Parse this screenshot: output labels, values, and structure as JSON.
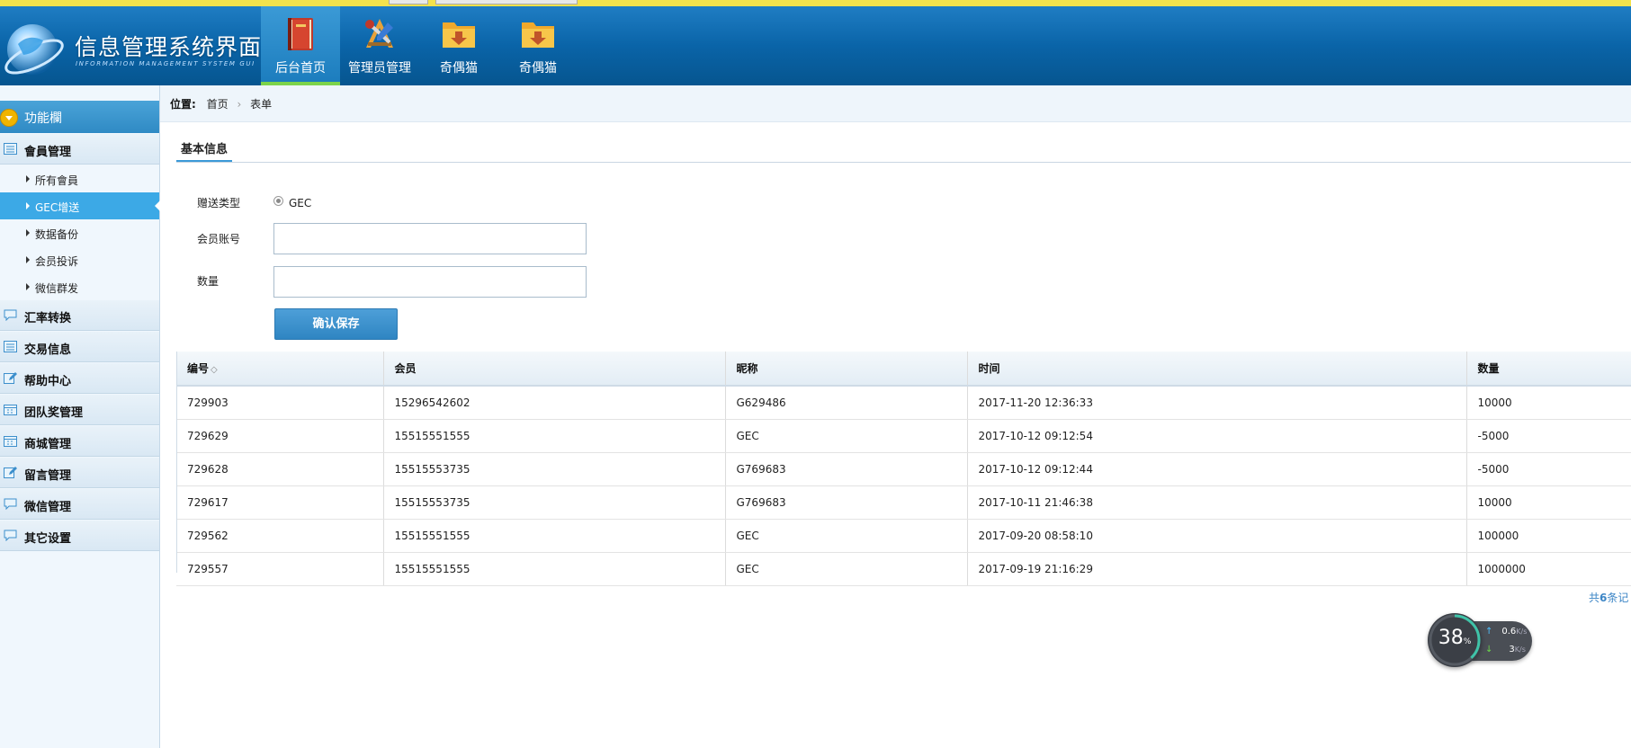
{
  "header": {
    "title": "信息管理系统界面",
    "subtitle": "INFORMATION MANAGEMENT SYSTEM GUI",
    "nav": [
      {
        "label": "后台首页",
        "icon": "book-icon",
        "active": true
      },
      {
        "label": "管理员管理",
        "icon": "tools-icon",
        "active": false
      },
      {
        "label": "奇偶猫",
        "icon": "folder-download-icon",
        "active": false
      },
      {
        "label": "奇偶猫",
        "icon": "folder-download-icon",
        "active": false
      }
    ]
  },
  "sidebar": {
    "heading": "功能欄",
    "groups": [
      {
        "label": "會員管理",
        "icon": "list-icon"
      },
      {
        "label": "汇率转换",
        "icon": "chat-icon"
      },
      {
        "label": "交易信息",
        "icon": "list-icon"
      },
      {
        "label": "帮助中心",
        "icon": "edit-icon"
      },
      {
        "label": "团队奖管理",
        "icon": "calendar-icon"
      },
      {
        "label": "商城管理",
        "icon": "calendar-icon"
      },
      {
        "label": "留言管理",
        "icon": "edit-icon"
      },
      {
        "label": "微信管理",
        "icon": "chat-icon"
      },
      {
        "label": "其它设置",
        "icon": "chat-icon"
      }
    ],
    "sub_items": [
      {
        "label": "所有會員",
        "active": false
      },
      {
        "label": "GEC增送",
        "active": true
      },
      {
        "label": "数据备份",
        "active": false
      },
      {
        "label": "会员投诉",
        "active": false
      },
      {
        "label": "微信群发",
        "active": false
      }
    ]
  },
  "breadcrumb": {
    "prefix": "位置:",
    "home": "首页",
    "separator": "›",
    "current": "表单"
  },
  "form": {
    "tab_title": "基本信息",
    "type_label": "赠送类型",
    "type_option": "GEC",
    "account_label": "会员账号",
    "account_value": "",
    "quantity_label": "数量",
    "quantity_value": "",
    "submit_label": "确认保存"
  },
  "table": {
    "headers": [
      "编号",
      "会员",
      "昵称",
      "时间",
      "数量"
    ],
    "sort_glyph": "◇",
    "rows": [
      [
        "729903",
        "15296542602",
        "G629486",
        "2017-11-20 12:36:33",
        "10000"
      ],
      [
        "729629",
        "15515551555",
        "GEC",
        "2017-10-12 09:12:54",
        "-5000"
      ],
      [
        "729628",
        "15515553735",
        "G769683",
        "2017-10-12 09:12:44",
        "-5000"
      ],
      [
        "729617",
        "15515553735",
        "G769683",
        "2017-10-11 21:46:38",
        "10000"
      ],
      [
        "729562",
        "15515551555",
        "GEC",
        "2017-09-20 08:58:10",
        "100000"
      ],
      [
        "729557",
        "15515551555",
        "GEC",
        "2017-09-19 21:16:29",
        "1000000"
      ]
    ]
  },
  "pager": {
    "prefix": "共",
    "count": "6",
    "suffix": "条记"
  },
  "speed_widget": {
    "percent": "38",
    "percent_unit": "%",
    "up_value": "0.6",
    "down_value": "3",
    "unit": "K/s"
  },
  "colors": {
    "header": "#0a64a8",
    "active_nav_underline": "#7cd34a",
    "sidebar_active": "#3ca9e6",
    "button": "#3a8fcb"
  }
}
